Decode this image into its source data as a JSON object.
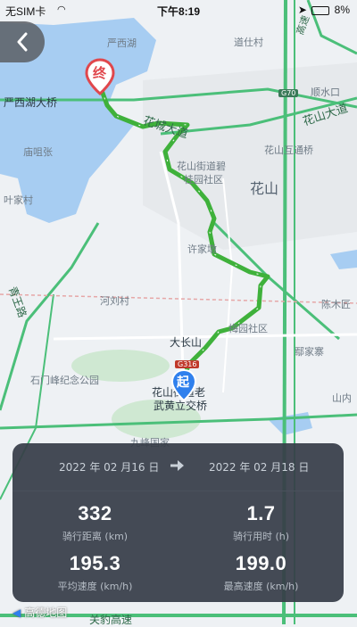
{
  "status": {
    "carrier": "无SIM卡",
    "time": "下午8:19",
    "battery": "8%"
  },
  "map": {
    "labels": {
      "yanxihu": "严西湖",
      "daoshicun": "道仕村",
      "yanxihu_bridge": "严西湖大桥",
      "huacheng_road": "花城大道",
      "huashan_road": "花山大道",
      "shunshuikou": "顺水口",
      "miaozhangzhang": "庙咀张",
      "huashan_interchange": "花山互通桥",
      "huashan_jiedao": "花山街道碧",
      "guiyuan": "桂园社区",
      "huashan": "花山",
      "yejiacun": "叶家村",
      "xujiadun": "许家墩",
      "heliucun": "河刘村",
      "qingwanglu": "青王路",
      "chenmuzhe": "陈木匠",
      "dachangshan": "大长山",
      "meiyuan": "梅园社区",
      "zhengjiazhai": "鄢家寨",
      "shimenfeng": "石门峰纪念公园",
      "huashan_station": "花山街道老",
      "wuhuang": "武黄立交桥",
      "jiufeng": "九峰国家",
      "shan_nei": "山内",
      "gaosu_top": "高速",
      "guanbao": "关豹高速",
      "g70": "G70",
      "g316": "G316",
      "road_yan": "严西湖"
    },
    "start_label": "起",
    "end_label": "终"
  },
  "panel": {
    "start_date": "2022 年 02 月16 日",
    "end_date": "2022 年 02 月18 日",
    "distance_value": "332",
    "distance_label": "骑行距离 (km)",
    "duration_value": "1.7",
    "duration_label": "骑行用时 (h)",
    "avg_speed_value": "195.3",
    "avg_speed_label": "平均速度 (km/h)",
    "max_speed_value": "199.0",
    "max_speed_label": "最高速度 (km/h)"
  },
  "logo": "高德地图",
  "colors": {
    "route": "#3fb13b",
    "panel": "#373d48",
    "water": "#a7cdf2",
    "highway": "#4bbf79"
  }
}
